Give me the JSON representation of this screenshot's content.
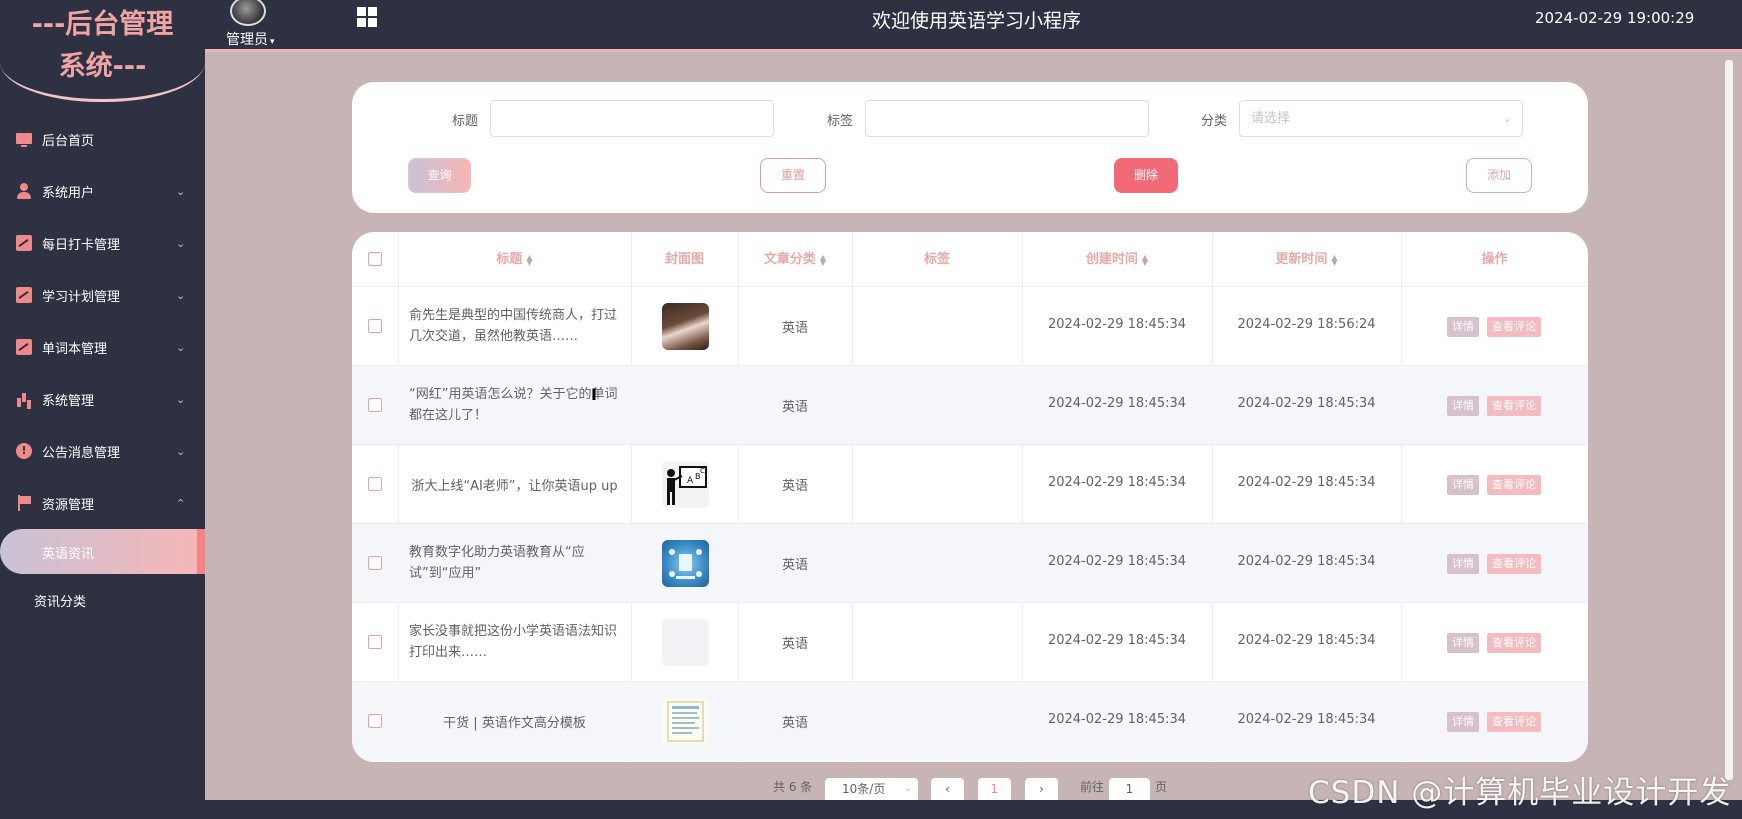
{
  "header": {
    "logo_line1": "---后台管理",
    "logo_line2": "系统---",
    "admin_label": "管理员",
    "welcome": "欢迎使用英语学习小程序",
    "datetime": "2024-02-29 19:00:29"
  },
  "sidebar": {
    "items": [
      {
        "label": "后台首页",
        "icon": "monitor-icon"
      },
      {
        "label": "系统用户",
        "icon": "user-icon"
      },
      {
        "label": "每日打卡管理",
        "icon": "chart-icon"
      },
      {
        "label": "学习计划管理",
        "icon": "chart-icon"
      },
      {
        "label": "单词本管理",
        "icon": "chart-icon"
      },
      {
        "label": "系统管理",
        "icon": "bar-chart-icon"
      },
      {
        "label": "公告消息管理",
        "icon": "info-icon"
      },
      {
        "label": "资源管理",
        "icon": "flag-icon"
      }
    ],
    "sub_items": [
      {
        "label": "英语资讯",
        "active": true
      },
      {
        "label": "资讯分类",
        "active": false
      }
    ]
  },
  "search": {
    "title_label": "标题",
    "tag_label": "标签",
    "category_label": "分类",
    "category_placeholder": "请选择",
    "query_button": "查询",
    "reset_button": "重置",
    "delete_button": "删除",
    "add_button": "添加"
  },
  "table": {
    "headers": {
      "title": "标题",
      "cover": "封面图",
      "category": "文章分类",
      "tag": "标签",
      "created": "创建时间",
      "updated": "更新时间",
      "actions": "操作"
    },
    "rows": [
      {
        "title": "俞先生是典型的中国传统商人，打过几次交道，虽然他教英语……",
        "category": "英语",
        "tag": "",
        "created": "2024-02-29 18:45:34",
        "updated": "2024-02-29 18:56:24",
        "cover": "portrait"
      },
      {
        "title": "“网红”用英语怎么说？关于它的单词都在这儿了！",
        "category": "英语",
        "tag": "",
        "created": "2024-02-29 18:45:34",
        "updated": "2024-02-29 18:45:34",
        "cover": "none"
      },
      {
        "title": "浙大上线“AI老师”，让你英语up up",
        "category": "英语",
        "tag": "",
        "created": "2024-02-29 18:45:34",
        "updated": "2024-02-29 18:45:34",
        "cover": "teacher"
      },
      {
        "title": "教育数字化助力英语教育从“应试”到“应用”",
        "category": "英语",
        "tag": "",
        "created": "2024-02-29 18:45:34",
        "updated": "2024-02-29 18:45:34",
        "cover": "digital"
      },
      {
        "title": "家长没事就把这份小学英语语法知识打印出来……",
        "category": "英语",
        "tag": "",
        "created": "2024-02-29 18:45:34",
        "updated": "2024-02-29 18:45:34",
        "cover": "blank"
      },
      {
        "title": "干货 | 英语作文高分模板",
        "category": "英语",
        "tag": "",
        "created": "2024-02-29 18:45:34",
        "updated": "2024-02-29 18:45:34",
        "cover": "document"
      }
    ],
    "detail_label": "详情",
    "comment_label": "查看评论"
  },
  "pagination": {
    "total": "共 6 条",
    "page_size": "10条/页",
    "current_page": "1",
    "goto_label": "前往",
    "goto_value": "1",
    "page_suffix": "页"
  },
  "watermark": "CSDN @计算机毕业设计开发"
}
